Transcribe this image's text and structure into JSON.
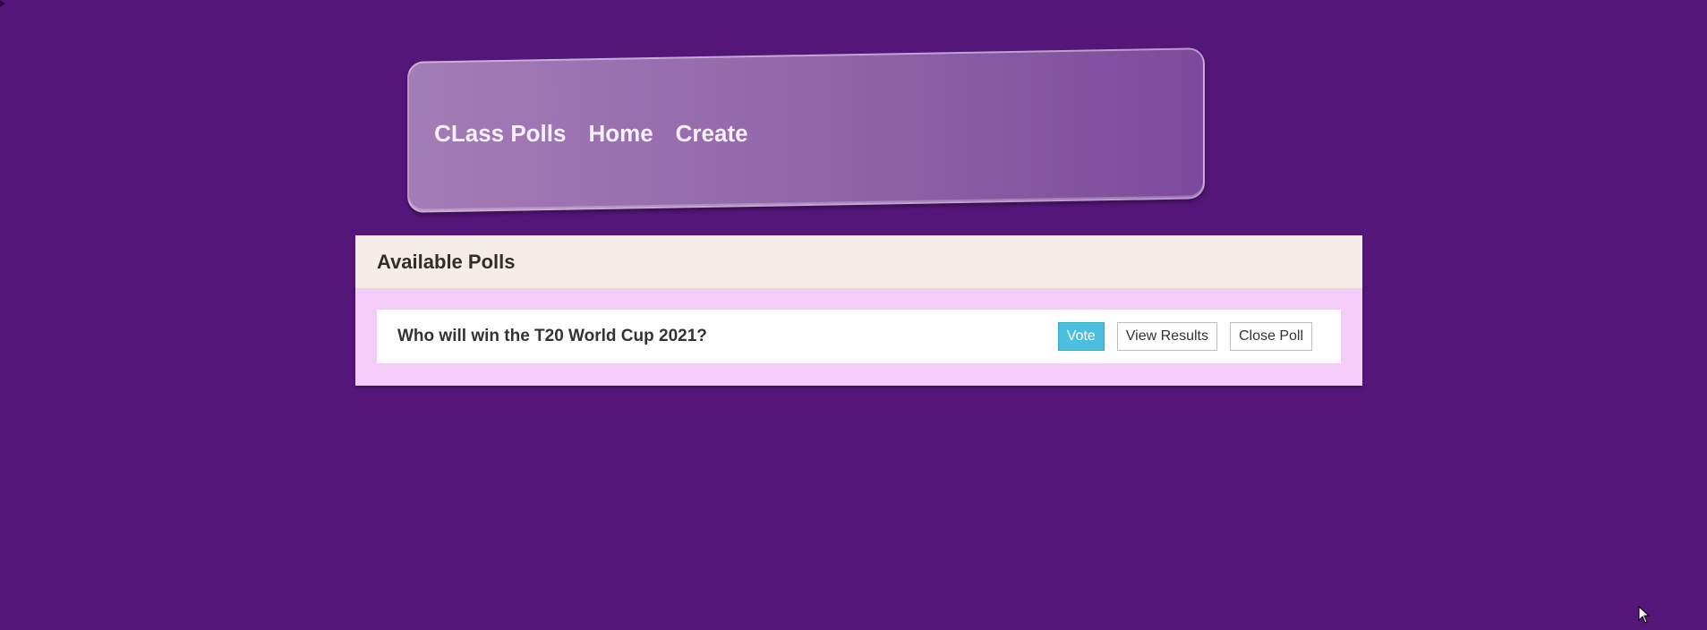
{
  "navbar": {
    "brand": "CLass Polls",
    "links": [
      {
        "label": "Home"
      },
      {
        "label": "Create"
      }
    ]
  },
  "polls_panel": {
    "title": "Available Polls",
    "items": [
      {
        "question": "Who will win the T20 World Cup 2021?",
        "vote_label": "Vote",
        "view_results_label": "View Results",
        "close_poll_label": "Close Poll"
      }
    ]
  },
  "colors": {
    "page_background": "#55167a",
    "navbar_gradient_start": "#a37db6",
    "navbar_gradient_end": "#7c4a9c",
    "card_header": "#f4ece6",
    "card_body": "#f4ccf8",
    "vote_button": "#4bbfe0"
  },
  "icons": {
    "cursor": "mouse-pointer-icon"
  }
}
